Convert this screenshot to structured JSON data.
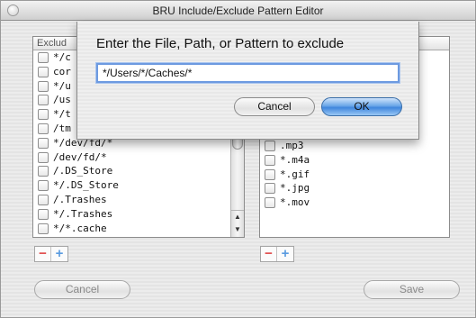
{
  "window": {
    "title": "BRU Include/Exclude Pattern Editor"
  },
  "exclude_list": {
    "header": "Exclud",
    "items": [
      "*/c",
      "cor",
      "*/u",
      "/us",
      "*/t",
      "/tm",
      "*/dev/fd/*",
      "/dev/fd/*",
      "/.DS_Store",
      "*/.DS_Store",
      "/.Trashes",
      "*/.Trashes",
      "*/*.cache"
    ]
  },
  "include_list": {
    "items": [
      ".mp3",
      "*.m4a",
      "*.gif",
      "*.jpg",
      "*.mov"
    ]
  },
  "buttons": {
    "cancel": "Cancel",
    "save": "Save"
  },
  "sheet": {
    "prompt": "Enter the File, Path, or Pattern to exclude",
    "input_value": "*/Users/*/Caches/*",
    "cancel": "Cancel",
    "ok": "OK"
  },
  "scroll_arrows": {
    "up": "▲",
    "down": "▼"
  },
  "pm": {
    "minus": "−",
    "plus": "+"
  }
}
